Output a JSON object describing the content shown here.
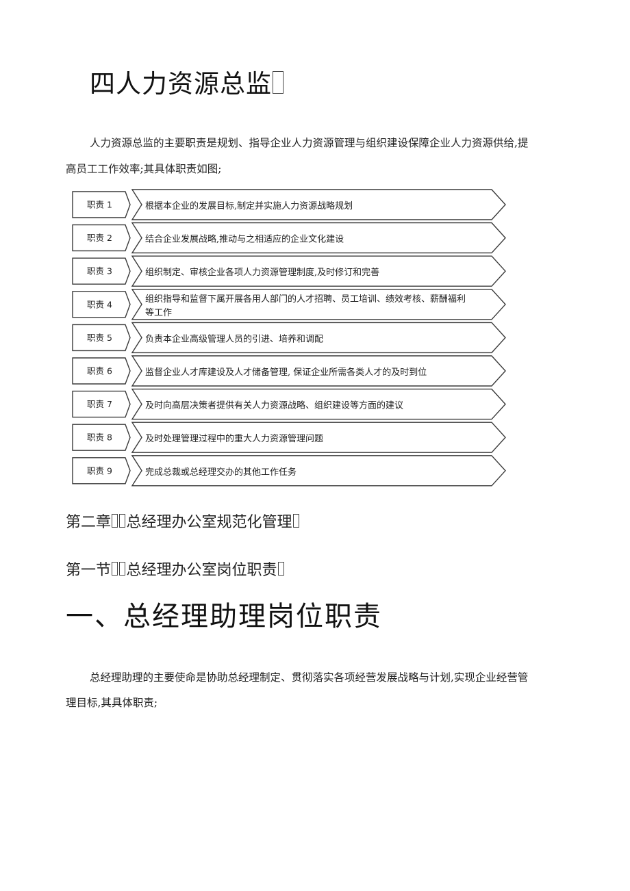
{
  "section_title": "四人力资源总监",
  "intro": {
    "line1": "人力资源总监的主要职责是规划、指导企业人力资源管理与组织建设保障企业人力资源供给,提",
    "line2": "高员工工作效率;其具体职责如图;"
  },
  "duties": [
    {
      "label": "职责 1",
      "lines": [
        "根据本企业的发展目标,制定并实施人力资源战略规划"
      ]
    },
    {
      "label": "职责 2",
      "lines": [
        "结合企业发展战略,推动与之相适应的企业文化建设"
      ]
    },
    {
      "label": "职责 3",
      "lines": [
        "组织制定、审核企业各项人力资源管理制度,及时修订和完善"
      ]
    },
    {
      "label": "职责 4",
      "lines": [
        "组织指导和监督下属开展各用人部门的人才招聘、员工培训、绩效考核、薪酬福利",
        "等工作"
      ]
    },
    {
      "label": "职责 5",
      "lines": [
        "负责本企业高级管理人员的引进、培养和调配"
      ]
    },
    {
      "label": "职责 6",
      "lines": [
        "监督企业人才库建设及人才储备管理, 保证企业所需各类人才的及时到位"
      ]
    },
    {
      "label": "职责 7",
      "lines": [
        "及时向高层决策者提供有关人力资源战略、组织建设等方面的建议"
      ]
    },
    {
      "label": "职责 8",
      "lines": [
        "及时处理管理过程中的重大人力资源管理问题"
      ]
    },
    {
      "label": "职责 9",
      "lines": [
        "完成总裁或总经理交办的其他工作任务"
      ]
    }
  ],
  "chapter_heading": {
    "prefix": "第二章",
    "title": "总经理办公室规范化管理"
  },
  "section_heading": {
    "prefix": "第一节",
    "title": "总经理办公室岗位职责"
  },
  "subsection_title": "一、总经理助理岗位职责",
  "outro": {
    "line1": "总经理助理的主要使命是协助总经理制定、贯彻落实各项经营发展战略与计划,实现企业经营管",
    "line2": "理目标,其具体职责;"
  },
  "colors": {
    "text": "#222222",
    "shape_stroke": "#3a3a3a",
    "shape_fill": "#ffffff"
  }
}
